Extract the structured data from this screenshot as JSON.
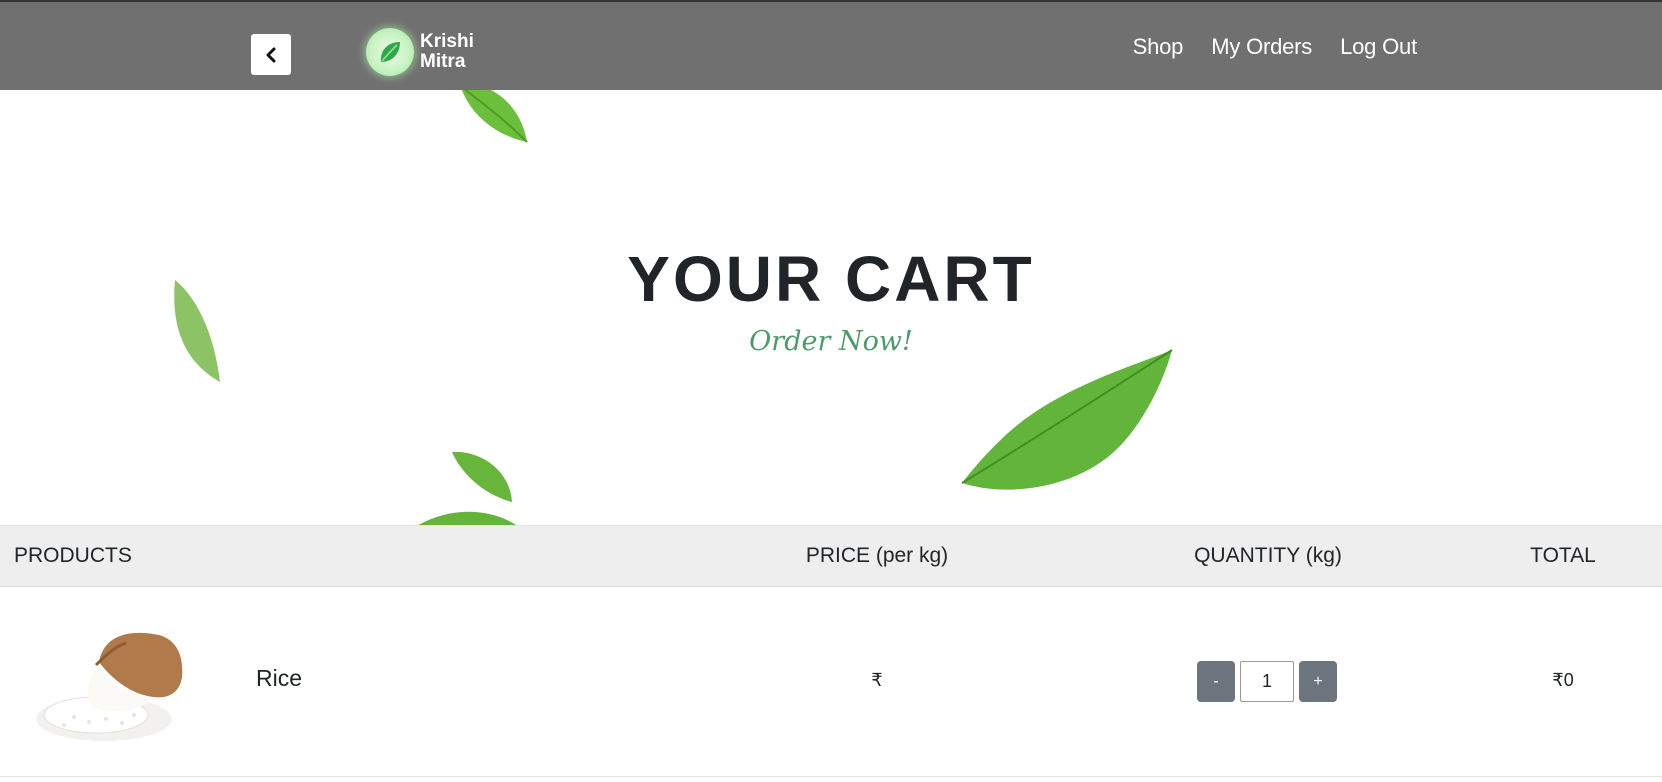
{
  "navbar": {
    "brand_line1": "Krishi",
    "brand_line2": "Mitra",
    "links": [
      "Shop",
      "My Orders",
      "Log Out"
    ],
    "background": "#707070",
    "back_icon": "chevron-left-icon"
  },
  "hero": {
    "title": "YOUR CART",
    "subtitle": "Order Now!",
    "subtitle_color": "#4a9a6a"
  },
  "cart_table": {
    "headers": {
      "products": "PRODUCTS",
      "price": "PRICE (per kg)",
      "quantity": "QUANTITY (kg)",
      "total": "TOTAL"
    },
    "rows": [
      {
        "product": "Rice",
        "price": "₹",
        "quantity": "1",
        "decrement": "-",
        "increment": "+",
        "total": "₹0"
      }
    ]
  }
}
